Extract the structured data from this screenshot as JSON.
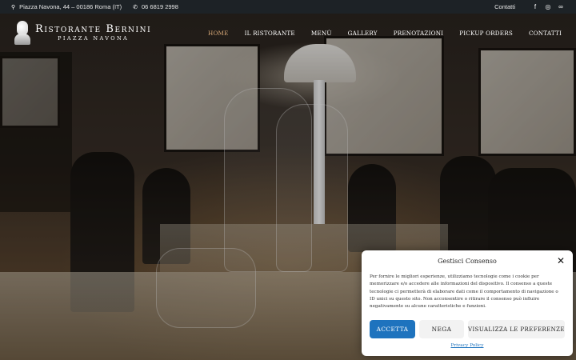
{
  "topbar": {
    "address": "Piazza Navona, 44 – 00186 Roma (IT)",
    "phone": "06 6819 2998",
    "contact_link": "Contatti",
    "social": [
      {
        "icon": "facebook-icon",
        "glyph": "f"
      },
      {
        "icon": "instagram-icon",
        "glyph": "◎"
      },
      {
        "icon": "tripadvisor-icon",
        "glyph": "∞"
      }
    ]
  },
  "logo": {
    "title": "Ristorante Bernini",
    "subtitle": "PIAZZA NAVONA"
  },
  "nav": {
    "items": [
      {
        "label": "HOME",
        "active": true
      },
      {
        "label": "IL RISTORANTE",
        "active": false
      },
      {
        "label": "MENÙ",
        "active": false
      },
      {
        "label": "GALLERY",
        "active": false
      },
      {
        "label": "PRENOTAZIONI",
        "active": false
      },
      {
        "label": "PICKUP ORDERS",
        "active": false
      },
      {
        "label": "CONTATTI",
        "active": false
      }
    ]
  },
  "consent": {
    "title": "Gestisci Consenso",
    "close_glyph": "✕",
    "text": "Per fornire le migliori esperienze, utilizziamo tecnologie come i cookie per memorizzare e/o accedere alle informazioni del dispositivo. Il consenso a queste tecnologie ci permetterà di elaborare dati come il comportamento di navigazione o ID unici su questo sito. Non acconsentire o ritirare il consenso può influire negativamente su alcune caratteristiche e funzioni.",
    "accept_label": "ACCETTA",
    "deny_label": "NEGA",
    "prefs_label": "VISUALIZZA LE PREFERENZE",
    "policy_link": "Privacy Policy"
  },
  "colors": {
    "accent": "#1e73be",
    "nav_active": "#d8a878",
    "topbar_bg": "#1d2226"
  }
}
